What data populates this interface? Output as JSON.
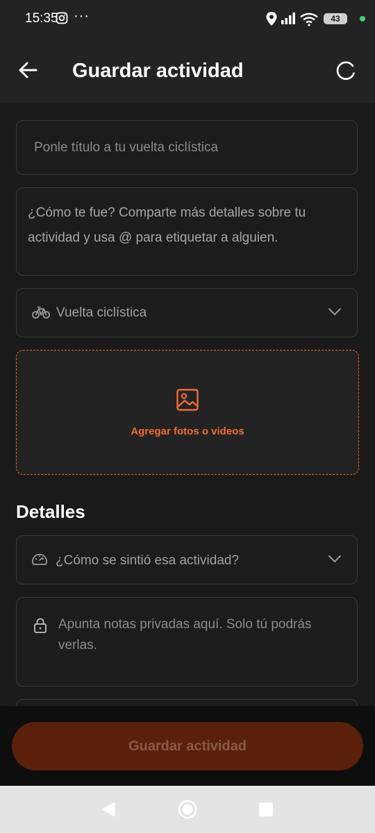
{
  "status_bar": {
    "time": "15:35",
    "more": "···",
    "battery": "43"
  },
  "header": {
    "title": "Guardar actividad"
  },
  "form": {
    "title_placeholder": "Ponle título a tu vuelta ciclística",
    "description_placeholder": "¿Cómo te fue? Comparte más detalles sobre tu actividad y usa @ para etiquetar a alguien.",
    "activity_type": "Vuelta ciclística",
    "media_label": "Agregar fotos o videos"
  },
  "details": {
    "section_title": "Detalles",
    "feel_placeholder": "¿Cómo se sintió esa actividad?",
    "notes_placeholder": "Apunta notas privadas aquí. Solo tú podrás verlas."
  },
  "bottom": {
    "save_label": "Guardar actividad"
  },
  "colors": {
    "accent": "#f06d33",
    "save_button_bg": "#5a200c",
    "background": "#1a1a1a"
  }
}
